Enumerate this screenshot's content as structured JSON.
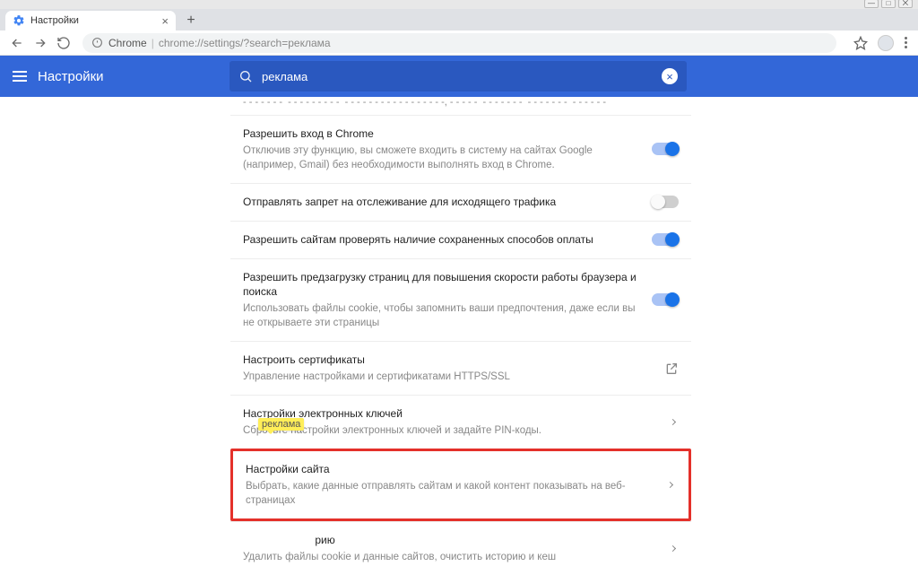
{
  "os": {
    "min": "—",
    "max": "□",
    "close": "⨉"
  },
  "tab": {
    "title": "Настройки"
  },
  "omnibox": {
    "chrome_label": "Chrome",
    "url": "chrome://settings/?search=реклама"
  },
  "header": {
    "title": "Настройки"
  },
  "search": {
    "value": "реклама"
  },
  "highlight_chip": "реклама",
  "rows": {
    "chrome_login": {
      "title": "Разрешить вход в Chrome",
      "sub": "Отключив эту функцию, вы сможете входить в систему на сайтах Google (например, Gmail) без необходимости выполнять вход в Chrome."
    },
    "dnt": {
      "title": "Отправлять запрет на отслеживание для исходящего трафика"
    },
    "payment": {
      "title": "Разрешить сайтам проверять наличие сохраненных способов оплаты"
    },
    "preload": {
      "title": "Разрешить предзагрузку страниц для повышения скорости работы браузера и поиска",
      "sub": "Использовать файлы cookie, чтобы запомнить ваши предпочтения, даже если вы не открываете эти страницы"
    },
    "certs": {
      "title": "Настроить сертификаты",
      "sub": "Управление настройками и сертификатами HTTPS/SSL"
    },
    "keys": {
      "title": "Настройки электронных ключей",
      "sub": "Сбросьте настройки электронных ключей и задайте PIN-коды."
    },
    "site": {
      "title": "Настройки сайта",
      "sub": "Выбрать, какие данные отправлять сайтам и какой контент показывать на веб-страницах"
    },
    "clear": {
      "title_suffix": "рию",
      "sub": "Удалить файлы cookie и данные сайтов, очистить историю и кеш"
    }
  }
}
